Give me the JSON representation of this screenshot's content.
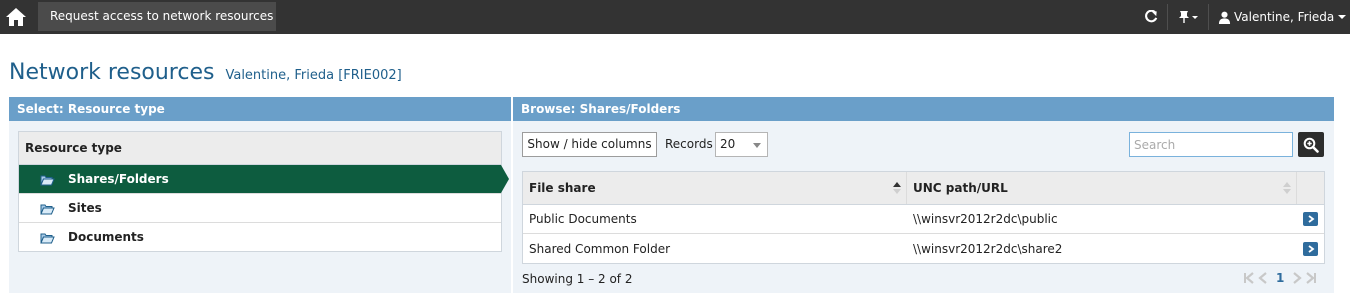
{
  "topbar": {
    "home_icon": "home-icon",
    "active_tab": "Request access to network resources",
    "refresh_icon": "refresh-icon",
    "pin_icon": "pushpin-icon",
    "user_icon": "user-icon",
    "user_name": "Valentine, Frieda"
  },
  "page": {
    "title": "Network resources",
    "subtitle": "Valentine, Frieda [FRIE002]"
  },
  "left_panel": {
    "header": "Select: Resource type",
    "list_header": "Resource type",
    "items": [
      {
        "label": "Shares/Folders",
        "active": true
      },
      {
        "label": "Sites",
        "active": false
      },
      {
        "label": "Documents",
        "active": false
      }
    ]
  },
  "right_panel": {
    "header": "Browse: Shares/Folders",
    "show_hide_label": "Show / hide columns",
    "records_label": "Records",
    "records_value": "20",
    "search_placeholder": "Search",
    "columns": [
      "File share",
      "UNC path/URL"
    ],
    "rows": [
      {
        "file_share": "Public Documents",
        "unc": "\\\\winsvr2012r2dc\\public"
      },
      {
        "file_share": "Shared Common Folder",
        "unc": "\\\\winsvr2012r2dc\\share2"
      }
    ],
    "showing": "Showing 1 – 2 of 2",
    "current_page": "1"
  },
  "colors": {
    "topbar": "#333333",
    "panel_header": "#6a9fc9",
    "active_item": "#0d5c3f",
    "title": "#1f5f8b"
  }
}
